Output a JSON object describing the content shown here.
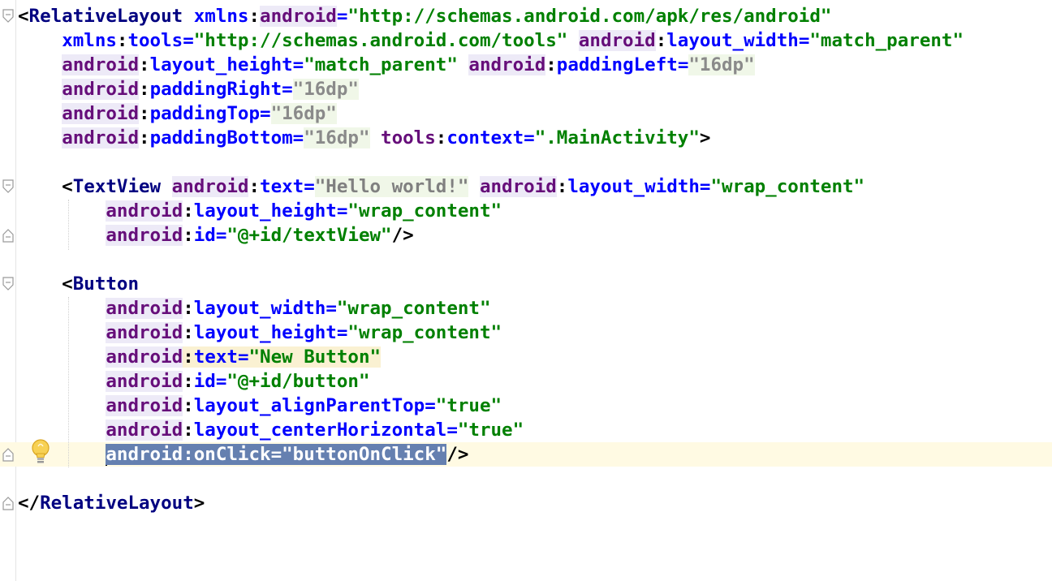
{
  "editor": {
    "lines": [
      [
        {
          "c": "t-punc",
          "t": "<"
        },
        {
          "c": "t-tag",
          "t": "RelativeLayout"
        },
        {
          "c": "t-punc",
          "t": " "
        },
        {
          "c": "t-attr",
          "t": "xmlns"
        },
        {
          "c": "t-punc",
          "t": ":"
        },
        {
          "c": "t-ns",
          "t": "android"
        },
        {
          "c": "t-attr",
          "t": "="
        },
        {
          "c": "t-str",
          "t": "\"http://schemas.android.com/apk/res/android\""
        }
      ],
      [
        {
          "c": "t-punc",
          "t": "    "
        },
        {
          "c": "t-attr",
          "t": "xmlns"
        },
        {
          "c": "t-punc",
          "t": ":"
        },
        {
          "c": "t-attr",
          "t": "tools"
        },
        {
          "c": "t-attr",
          "t": "="
        },
        {
          "c": "t-str",
          "t": "\"http://schemas.android.com/tools\""
        },
        {
          "c": "t-punc",
          "t": " "
        },
        {
          "c": "t-ns",
          "t": "android"
        },
        {
          "c": "t-punc",
          "t": ":"
        },
        {
          "c": "t-attr",
          "t": "layout_width"
        },
        {
          "c": "t-attr",
          "t": "="
        },
        {
          "c": "t-str",
          "t": "\"match_parent\""
        }
      ],
      [
        {
          "c": "t-punc",
          "t": "    "
        },
        {
          "c": "t-ns",
          "t": "android"
        },
        {
          "c": "t-punc",
          "t": ":"
        },
        {
          "c": "t-attr",
          "t": "layout_height"
        },
        {
          "c": "t-attr",
          "t": "="
        },
        {
          "c": "t-str",
          "t": "\"match_parent\""
        },
        {
          "c": "t-punc",
          "t": " "
        },
        {
          "c": "t-ns",
          "t": "android"
        },
        {
          "c": "t-punc",
          "t": ":"
        },
        {
          "c": "t-attr",
          "t": "paddingLeft"
        },
        {
          "c": "t-attr",
          "t": "="
        },
        {
          "c": "t-num hl-green",
          "t": "\"16dp\""
        }
      ],
      [
        {
          "c": "t-punc",
          "t": "    "
        },
        {
          "c": "t-ns",
          "t": "android"
        },
        {
          "c": "t-punc",
          "t": ":"
        },
        {
          "c": "t-attr",
          "t": "paddingRight"
        },
        {
          "c": "t-attr",
          "t": "="
        },
        {
          "c": "t-num hl-green",
          "t": "\"16dp\""
        }
      ],
      [
        {
          "c": "t-punc",
          "t": "    "
        },
        {
          "c": "t-ns",
          "t": "android"
        },
        {
          "c": "t-punc",
          "t": ":"
        },
        {
          "c": "t-attr",
          "t": "paddingTop"
        },
        {
          "c": "t-attr",
          "t": "="
        },
        {
          "c": "t-num hl-green",
          "t": "\"16dp\""
        }
      ],
      [
        {
          "c": "t-punc",
          "t": "    "
        },
        {
          "c": "t-ns",
          "t": "android"
        },
        {
          "c": "t-punc",
          "t": ":"
        },
        {
          "c": "t-attr",
          "t": "paddingBottom"
        },
        {
          "c": "t-attr",
          "t": "="
        },
        {
          "c": "t-num hl-green",
          "t": "\"16dp\""
        },
        {
          "c": "t-punc",
          "t": " "
        },
        {
          "c": "t-ns2",
          "t": "tools"
        },
        {
          "c": "t-punc",
          "t": ":"
        },
        {
          "c": "t-attr",
          "t": "context"
        },
        {
          "c": "t-attr",
          "t": "="
        },
        {
          "c": "t-str",
          "t": "\".MainActivity\""
        },
        {
          "c": "t-punc",
          "t": ">"
        }
      ],
      [],
      [
        {
          "c": "t-punc",
          "t": "    <"
        },
        {
          "c": "t-tag",
          "t": "TextView"
        },
        {
          "c": "t-punc",
          "t": " "
        },
        {
          "c": "t-ns",
          "t": "android"
        },
        {
          "c": "t-punc",
          "t": ":"
        },
        {
          "c": "t-attr",
          "t": "text"
        },
        {
          "c": "t-attr",
          "t": "="
        },
        {
          "c": "t-gray hl-green",
          "t": "\"Hello world!\""
        },
        {
          "c": "t-punc",
          "t": " "
        },
        {
          "c": "t-ns",
          "t": "android"
        },
        {
          "c": "t-punc",
          "t": ":"
        },
        {
          "c": "t-attr",
          "t": "layout_width"
        },
        {
          "c": "t-attr",
          "t": "="
        },
        {
          "c": "t-str",
          "t": "\"wrap_content\""
        }
      ],
      [
        {
          "c": "t-punc",
          "t": "        "
        },
        {
          "c": "t-ns",
          "t": "android"
        },
        {
          "c": "t-punc",
          "t": ":"
        },
        {
          "c": "t-attr",
          "t": "layout_height"
        },
        {
          "c": "t-attr",
          "t": "="
        },
        {
          "c": "t-str",
          "t": "\"wrap_content\""
        }
      ],
      [
        {
          "c": "t-punc",
          "t": "        "
        },
        {
          "c": "t-ns",
          "t": "android"
        },
        {
          "c": "t-punc",
          "t": ":"
        },
        {
          "c": "t-attr",
          "t": "id"
        },
        {
          "c": "t-attr",
          "t": "="
        },
        {
          "c": "t-str",
          "t": "\"@+id/textView\""
        },
        {
          "c": "t-punc",
          "t": "/>"
        }
      ],
      [],
      [
        {
          "c": "t-punc",
          "t": "    <"
        },
        {
          "c": "t-tag",
          "t": "Button"
        }
      ],
      [
        {
          "c": "t-punc",
          "t": "        "
        },
        {
          "c": "t-ns",
          "t": "android"
        },
        {
          "c": "t-punc",
          "t": ":"
        },
        {
          "c": "t-attr",
          "t": "layout_width"
        },
        {
          "c": "t-attr",
          "t": "="
        },
        {
          "c": "t-str",
          "t": "\"wrap_content\""
        }
      ],
      [
        {
          "c": "t-punc",
          "t": "        "
        },
        {
          "c": "t-ns",
          "t": "android"
        },
        {
          "c": "t-punc",
          "t": ":"
        },
        {
          "c": "t-attr",
          "t": "layout_height"
        },
        {
          "c": "t-attr",
          "t": "="
        },
        {
          "c": "t-str",
          "t": "\"wrap_content\""
        }
      ],
      [
        {
          "c": "t-punc",
          "t": "        "
        },
        {
          "c": "t-ns",
          "t": "android"
        },
        {
          "c": "t-punc hl-yellow",
          "t": ":"
        },
        {
          "c": "t-attr hl-yellow",
          "t": "text"
        },
        {
          "c": "t-attr hl-yellow",
          "t": "="
        },
        {
          "c": "t-str hl-yellow",
          "t": "\"New Button\""
        }
      ],
      [
        {
          "c": "t-punc",
          "t": "        "
        },
        {
          "c": "t-ns",
          "t": "android"
        },
        {
          "c": "t-punc",
          "t": ":"
        },
        {
          "c": "t-attr",
          "t": "id"
        },
        {
          "c": "t-attr",
          "t": "="
        },
        {
          "c": "t-str",
          "t": "\"@+id/button\""
        }
      ],
      [
        {
          "c": "t-punc",
          "t": "        "
        },
        {
          "c": "t-ns",
          "t": "android"
        },
        {
          "c": "t-punc",
          "t": ":"
        },
        {
          "c": "t-attr",
          "t": "layout_alignParentTop"
        },
        {
          "c": "t-attr",
          "t": "="
        },
        {
          "c": "t-str",
          "t": "\"true\""
        }
      ],
      [
        {
          "c": "t-punc",
          "t": "        "
        },
        {
          "c": "t-ns",
          "t": "android"
        },
        {
          "c": "t-punc",
          "t": ":"
        },
        {
          "c": "t-attr",
          "t": "layout_centerHorizontal"
        },
        {
          "c": "t-attr",
          "t": "="
        },
        {
          "c": "t-str",
          "t": "\"true\""
        }
      ],
      [
        {
          "c": "t-punc",
          "t": "        "
        },
        {
          "c": "caret",
          "t": ""
        },
        {
          "c": "sel",
          "t": "android:onClick=\"buttonOnClick\""
        },
        {
          "c": "t-punc",
          "t": "/>"
        }
      ],
      [],
      [
        {
          "c": "t-punc",
          "t": "</"
        },
        {
          "c": "t-tag",
          "t": "RelativeLayout"
        },
        {
          "c": "t-punc",
          "t": ">"
        }
      ]
    ],
    "current_line": 18,
    "fold_markers": [
      {
        "line": 0,
        "kind": "open"
      },
      {
        "line": 7,
        "kind": "open"
      },
      {
        "line": 9,
        "kind": "close"
      },
      {
        "line": 11,
        "kind": "open"
      },
      {
        "line": 18,
        "kind": "close"
      },
      {
        "line": 20,
        "kind": "close"
      }
    ],
    "intention_icon": "lightbulb-icon",
    "colors": {
      "tag": "#000080",
      "namespace": "#660e7a",
      "attribute": "#0000ff",
      "string": "#008000",
      "selection": "#6580b0",
      "current_line": "#fffae3"
    }
  }
}
